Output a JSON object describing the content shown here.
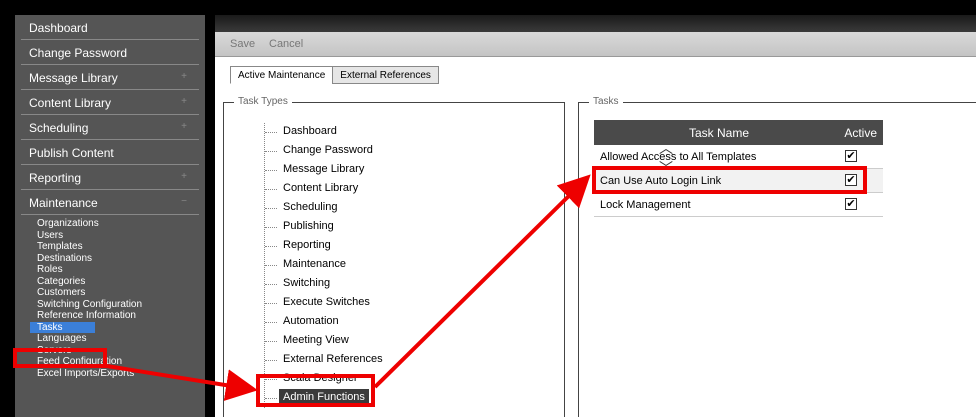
{
  "sidebar": {
    "main_items": [
      {
        "label": "Dashboard",
        "expandable": false
      },
      {
        "label": "Change Password",
        "expandable": false
      },
      {
        "label": "Message Library",
        "expandable": true
      },
      {
        "label": "Content Library",
        "expandable": true
      },
      {
        "label": "Scheduling",
        "expandable": true
      },
      {
        "label": "Publish Content",
        "expandable": false
      },
      {
        "label": "Reporting",
        "expandable": true
      },
      {
        "label": "Maintenance",
        "expandable": true
      }
    ],
    "expand_glyph": "+",
    "collapse_glyph": "−",
    "maintenance_items": [
      "Organizations",
      "Users",
      "Templates",
      "Destinations",
      "Roles",
      "Categories",
      "Customers",
      "Switching Configuration",
      "Reference Information",
      "Tasks",
      "Languages",
      "Servers",
      "Feed Configuration",
      "Excel Imports/Exports"
    ],
    "active_item": "Tasks"
  },
  "toolbar": {
    "save_label": "Save",
    "cancel_label": "Cancel"
  },
  "tabs": [
    {
      "label": "Active Maintenance",
      "active": true
    },
    {
      "label": "External References",
      "active": false
    }
  ],
  "task_types": {
    "legend": "Task Types",
    "items": [
      "Dashboard",
      "Change Password",
      "Message Library",
      "Content Library",
      "Scheduling",
      "Publishing",
      "Reporting",
      "Maintenance",
      "Switching",
      "Execute Switches",
      "Automation",
      "Meeting View",
      "External References",
      "Scala Designer",
      "Admin Functions"
    ],
    "selected": "Admin Functions"
  },
  "tasks": {
    "legend": "Tasks",
    "col_name": "Task Name",
    "col_active": "Active",
    "rows": [
      {
        "name": "Allowed Access to All Templates",
        "active": true
      },
      {
        "name": "Can Use Auto Login Link",
        "active": true
      },
      {
        "name": "Lock Management",
        "active": true
      }
    ],
    "check_glyph": "✔",
    "scroll_up_glyph": "︿",
    "scroll_down_glyph": "﹀"
  },
  "colors": {
    "highlight": "#e00000",
    "sidebar": "#555555",
    "selected": "#3b3b3b",
    "accent": "#3b7fd8"
  }
}
